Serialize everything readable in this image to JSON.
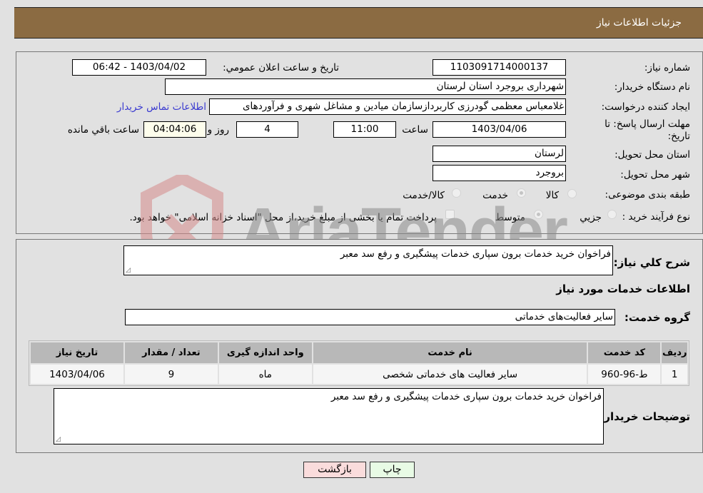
{
  "header": {
    "title": "جزئیات اطلاعات نیاز"
  },
  "details": {
    "need_number_label": "شماره نیاز:",
    "need_number": "1103091714000137",
    "announce_label": "تاريخ و ساعت اعلان عمومي:",
    "announce_value": "1403/04/02 - 06:42",
    "buyer_org_label": "نام دستگاه خريدار:",
    "buyer_org": "شهرداری بروجرد استان لرستان",
    "requester_label": "ايجاد كننده درخواست:",
    "requester": "غلامعباس معظمی گودرزی کاربردازسازمان میادین و مشاغل شهری و فرآوردهای",
    "contact_link": "اطلاعات تماس خريدار",
    "deadline_label_line1": "مهلت ارسال پاسخ: تا",
    "deadline_label_line2": "تاريخ:",
    "deadline_date": "1403/04/06",
    "time_label": "ساعت",
    "deadline_time": "11:00",
    "days_value": "4",
    "days_label": "روز و",
    "remaining_time": "04:04:06",
    "remaining_label": "ساعت باقي مانده",
    "province_label": "استان محل تحويل:",
    "province": "لرستان",
    "city_label": "شهر محل تحويل:",
    "city": "بروجرد",
    "category_label": "طبقه بندی موضوعی:",
    "category_options": [
      {
        "label": "كالا",
        "selected": false
      },
      {
        "label": "خدمت",
        "selected": true
      },
      {
        "label": "كالا/خدمت",
        "selected": false
      }
    ],
    "process_label": "نوع فرآيند خريد :",
    "process_options": [
      {
        "label": "جزيي",
        "selected": false
      },
      {
        "label": "متوسط",
        "selected": true
      }
    ],
    "treasury_checkbox_label": "پرداخت تمام يا بخشی از مبلغ خريد،از محل \"اسناد خزانه اسلامی\" خواهد بود.",
    "treasury_checked": false
  },
  "summary": {
    "description_label": "شرح كلي نياز:",
    "description": "فراخوان خرید خدمات برون سپاری خدمات پیشگیری و رفع سد معبر",
    "services_heading": "اطلاعات خدمات مورد نياز",
    "service_group_label": "گروه خدمت:",
    "service_group": "سایر فعالیت‌های خدماتی"
  },
  "table": {
    "headers": [
      "رديف",
      "كد خدمت",
      "نام خدمت",
      "واحد اندازه گيری",
      "تعداد / مقدار",
      "تاريخ نياز"
    ],
    "rows": [
      [
        "1",
        "ط-96-960",
        "سایر فعالیت های خدماتی شخصی",
        "ماه",
        "9",
        "1403/04/06"
      ]
    ]
  },
  "buyer_notes": {
    "label": "توضيحات خريدار:",
    "text": "فراخوان خرید خدمات برون سپاری خدمات پیشگیری و رفع سد معبر"
  },
  "buttons": {
    "print": "چاپ",
    "back": "بازگشت"
  },
  "watermark": {
    "text": "AriaTender.neT"
  }
}
